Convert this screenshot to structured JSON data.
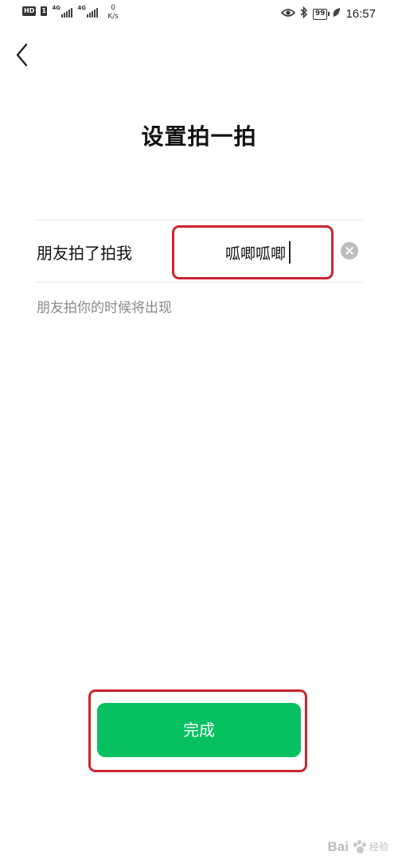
{
  "status_bar": {
    "hd": "HD",
    "sim": "1",
    "network1": "4G",
    "network2": "4G",
    "speed_value": "0",
    "speed_unit": "K/s",
    "battery": "99",
    "time": "16:57",
    "icons": [
      "eye-icon",
      "bluetooth-icon",
      "battery-icon",
      "leaf-icon"
    ]
  },
  "nav": {
    "back_icon": "chevron-left-icon"
  },
  "title": "设置拍一拍",
  "pat_row": {
    "label": "朋友拍了拍我",
    "value": "呱唧呱唧",
    "clear_icon": "clear-icon"
  },
  "hint": "朋友拍你的时候将出现",
  "done_button": "完成",
  "watermark": {
    "text": "Bai",
    "sub": "经验"
  },
  "colors": {
    "accent_green": "#07c160",
    "highlight_red": "#c9252d",
    "hint_gray": "#888888"
  }
}
